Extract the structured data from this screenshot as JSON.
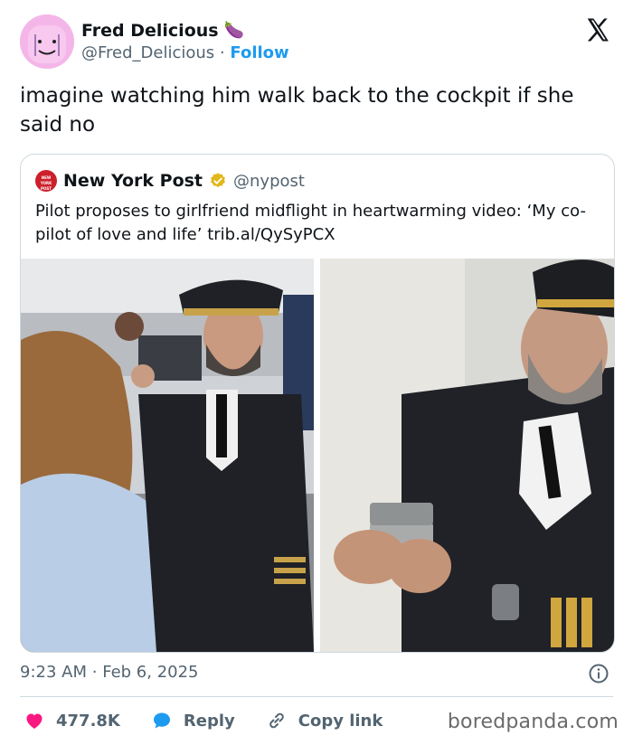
{
  "author": {
    "display_name": "Fred Delicious",
    "emoji": "🍆",
    "handle": "@Fred_Delicious",
    "separator": "·",
    "follow_label": "Follow",
    "avatar_color": "#f4b6e8"
  },
  "tweet": {
    "text": "imagine watching him walk back to the cockpit if she said no",
    "time": "9:23 AM",
    "separator": "·",
    "date": "Feb 6, 2025"
  },
  "quoted_tweet": {
    "name": "New York Post",
    "handle": "@nypost",
    "logo_text": "NEW YORK POST",
    "text": "Pilot proposes to girlfriend midflight in heartwarming video: ‘My co-pilot of love and life’ trib.al/QySyPCX"
  },
  "actions": {
    "like_count": "477.8K",
    "reply_label": "Reply",
    "copy_link_label": "Copy link"
  },
  "watermark": "boredpanda.com",
  "colors": {
    "accent": "#1d9bf0",
    "like": "#f91880",
    "verified": "#e2b719",
    "brand_red": "#cc1f2c"
  }
}
